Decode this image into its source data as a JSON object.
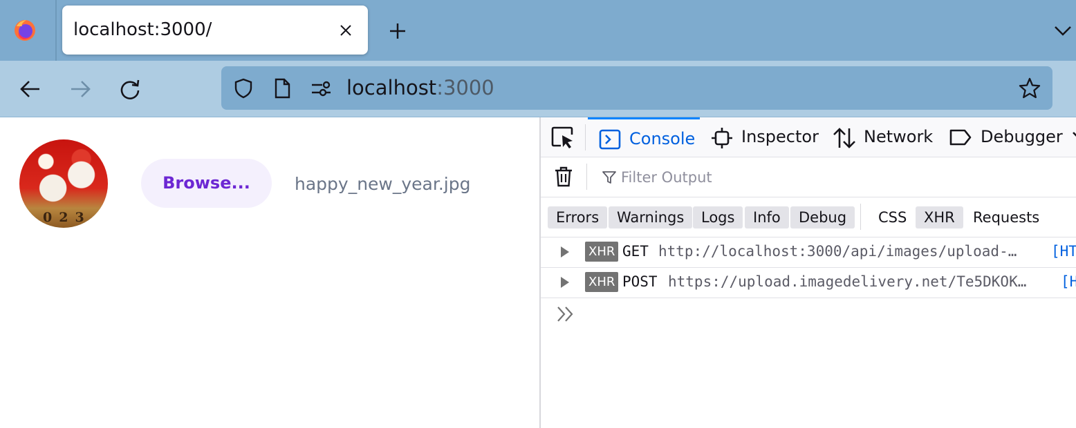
{
  "browser": {
    "tab": {
      "title": "localhost:3000/"
    },
    "urlbar": {
      "host": "localhost",
      "port": ":3000"
    },
    "icons": {
      "app": "firefox-logo-icon",
      "tab_close": "close-icon",
      "new_tab": "plus-icon",
      "list_all_tabs": "chevron-down-icon",
      "back": "back-arrow-icon",
      "forward": "forward-arrow-icon",
      "reload": "reload-icon",
      "tracking_protection": "shield-icon",
      "page_info": "page-icon",
      "permissions": "permissions-icon",
      "bookmark": "star-icon"
    },
    "colors": {
      "chrome": "#7eabce",
      "navbar": "#aecce2"
    }
  },
  "page": {
    "browse_label": "Browse...",
    "filename": "happy_new_year.jpg",
    "avatar_text": "023",
    "colors": {
      "button_bg": "#f4f0fd",
      "button_text": "#6c27d3",
      "filename_text": "#6a7588"
    }
  },
  "devtools": {
    "tabs": [
      {
        "label": "Console",
        "icon": "console-icon",
        "selected": true
      },
      {
        "label": "Inspector",
        "icon": "inspector-icon",
        "selected": false
      },
      {
        "label": "Network",
        "icon": "network-icon",
        "selected": false
      },
      {
        "label": "Debugger",
        "icon": "debugger-icon",
        "selected": false
      }
    ],
    "filter_placeholder": "Filter Output",
    "level_filters": [
      {
        "label": "Errors",
        "active": true
      },
      {
        "label": "Warnings",
        "active": true
      },
      {
        "label": "Logs",
        "active": true
      },
      {
        "label": "Info",
        "active": true
      },
      {
        "label": "Debug",
        "active": true
      }
    ],
    "type_filters": [
      {
        "label": "CSS",
        "active": false
      },
      {
        "label": "XHR",
        "active": true
      },
      {
        "label": "Requests",
        "active": false
      }
    ],
    "messages": [
      {
        "badge": "XHR",
        "method": "GET",
        "url": "http://localhost:3000/api/images/upload-…",
        "status": "[HT"
      },
      {
        "badge": "XHR",
        "method": "POST",
        "url": "https://upload.imagedelivery.net/Te5DKOK…",
        "status": "[H"
      }
    ],
    "colors": {
      "accent": "#0060df",
      "selected_tab_border": "#0a84ff",
      "badge": "#737373"
    }
  }
}
